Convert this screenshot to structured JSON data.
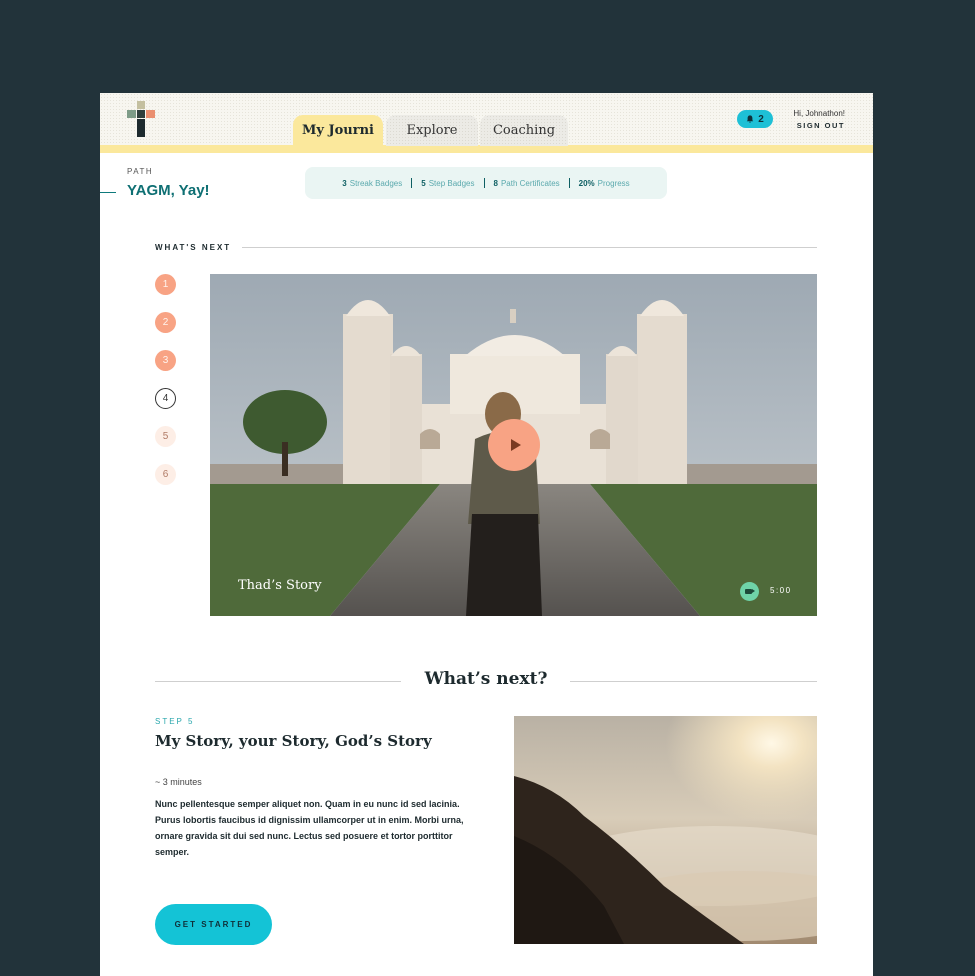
{
  "header": {
    "tabs": [
      {
        "label": "My Journi",
        "active": true
      },
      {
        "label": "Explore",
        "active": false
      },
      {
        "label": "Coaching",
        "active": false
      }
    ],
    "notifications": "2",
    "greeting": "Hi, Johnathon!",
    "sign_out": "SIGN OUT"
  },
  "path": {
    "label": "PATH",
    "name": "YAGM, Yay!",
    "stats": [
      {
        "value": "3",
        "label": "Streak Badges"
      },
      {
        "value": "5",
        "label": "Step Badges"
      },
      {
        "value": "8",
        "label": "Path Certificates"
      },
      {
        "value": "20%",
        "label": "Progress"
      }
    ]
  },
  "whats_next": {
    "label": "WHAT'S NEXT",
    "steps": [
      "1",
      "2",
      "3",
      "4",
      "5",
      "6"
    ],
    "video": {
      "title": "Thad’s Story",
      "duration": "5:00"
    }
  },
  "next_section": {
    "title": "What’s next?",
    "step_no": "STEP 5",
    "step_title": "My Story, your Story, God’s Story",
    "duration": "~ 3 minutes",
    "description": "Nunc pellentesque semper aliquet non. Quam in eu nunc id sed lacinia. Purus lobortis faucibus id dignissim ullamcorper ut in enim. Morbi urna, ornare gravida sit dui sed nunc. Lectus sed posuere et tortor porttitor semper.",
    "cta": "GET STARTED"
  },
  "colors": {
    "background": "#22333a",
    "accent_yellow": "#fbe89c",
    "accent_coral": "#f8a384",
    "accent_teal": "#14c3d6",
    "path_teal": "#0e6f73"
  }
}
